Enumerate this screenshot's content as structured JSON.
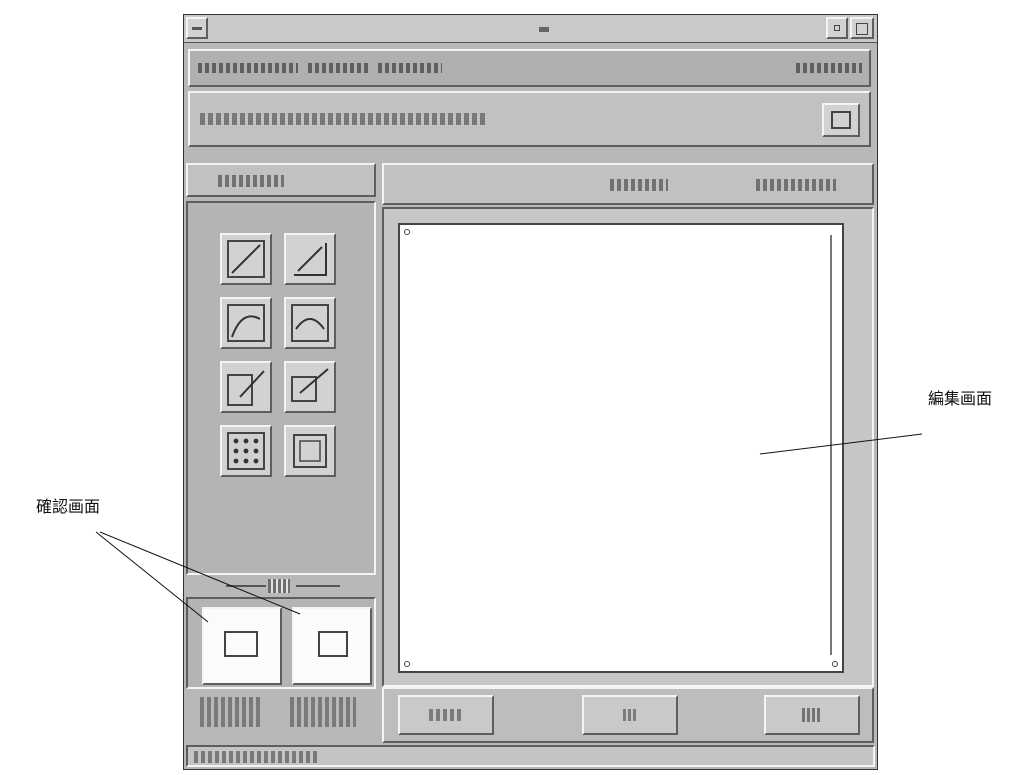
{
  "annotations": {
    "editor": "編集画面",
    "preview": "確認画面"
  },
  "window": {
    "icons": {
      "system_menu": "system-menu-icon",
      "minimize": "minimize-icon",
      "maximize": "maximize-icon"
    }
  },
  "toolbar": {
    "right_button_icon": "frame-icon"
  },
  "tools": [
    {
      "icon": "tool-line-diagonal-icon"
    },
    {
      "icon": "tool-line-corner-icon"
    },
    {
      "icon": "tool-curve-icon"
    },
    {
      "icon": "tool-curve-alt-icon"
    },
    {
      "icon": "tool-pen-icon"
    },
    {
      "icon": "tool-pen-alt-icon"
    },
    {
      "icon": "tool-dot-grid-icon"
    },
    {
      "icon": "tool-square-frame-icon"
    }
  ],
  "preview": {
    "icons": [
      "preview-frame-icon",
      "preview-page-icon"
    ]
  }
}
